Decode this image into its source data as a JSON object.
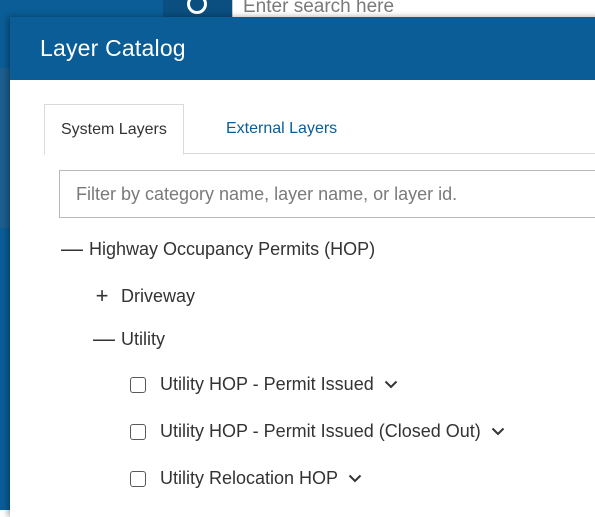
{
  "background": {
    "search_placeholder": "Enter search here"
  },
  "modal": {
    "title": "Layer Catalog"
  },
  "tabs": [
    {
      "label": "System Layers",
      "active": true
    },
    {
      "label": "External Layers",
      "active": false
    }
  ],
  "filter": {
    "placeholder": "Filter by category name, layer name, or layer id.",
    "value": ""
  },
  "tree": {
    "category": {
      "toggle": "—",
      "label": "Highway Occupancy Permits (HOP)",
      "expanded": true
    },
    "children": [
      {
        "toggle": "+",
        "label": "Driveway",
        "expanded": false
      },
      {
        "toggle": "—",
        "label": "Utility",
        "expanded": true
      }
    ],
    "layers": [
      {
        "label": "Utility HOP - Permit Issued",
        "checked": false
      },
      {
        "label": "Utility HOP - Permit Issued (Closed Out)",
        "checked": false
      },
      {
        "label": "Utility Relocation HOP",
        "checked": false
      }
    ]
  },
  "colors": {
    "header": "#0a5d96",
    "link": "#0a5d96",
    "text": "#333333"
  },
  "icons": {
    "search": "search-icon",
    "collapse": "minus-icon",
    "expand": "plus-icon",
    "checkbox": "checkbox-icon",
    "chevron": "chevron-down-icon"
  }
}
